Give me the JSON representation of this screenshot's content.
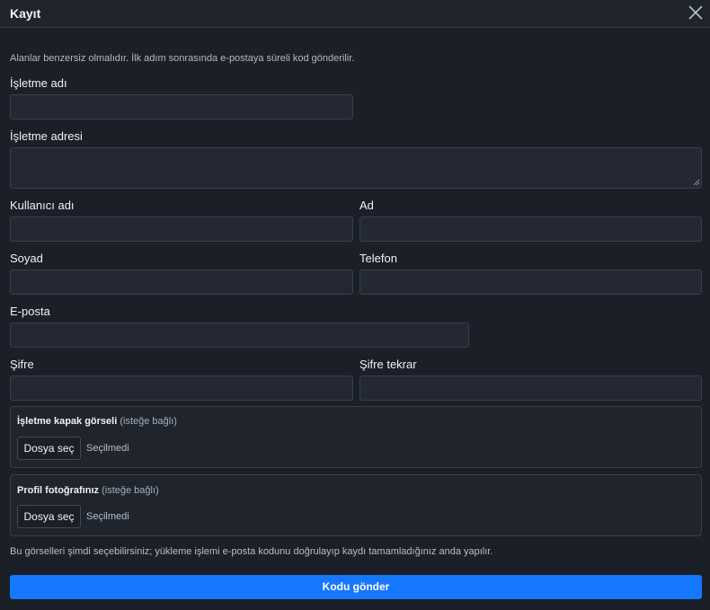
{
  "dialog": {
    "title": "Kayıt",
    "intro": "Alanlar benzersiz olmalıdır. İlk adım sonrasında e-postaya süreli kod gönderilir."
  },
  "form": {
    "business_name": {
      "label": "İşletme adı",
      "value": ""
    },
    "business_address": {
      "label": "İşletme adresi",
      "value": ""
    },
    "username": {
      "label": "Kullanıcı adı",
      "value": ""
    },
    "first_name": {
      "label": "Ad",
      "value": ""
    },
    "last_name": {
      "label": "Soyad",
      "value": ""
    },
    "phone": {
      "label": "Telefon",
      "value": ""
    },
    "email": {
      "label": "E-posta",
      "value": ""
    },
    "password": {
      "label": "Şifre",
      "value": ""
    },
    "password_confirm": {
      "label": "Şifre tekrar",
      "value": ""
    }
  },
  "uploads": {
    "cover": {
      "label": "İşletme kapak görseli",
      "optional": "(isteğe bağlı)",
      "button": "Dosya seç",
      "status": "Seçilmedi"
    },
    "profile": {
      "label": "Profil fotoğrafınız",
      "optional": "(isteğe bağlı)",
      "button": "Dosya seç",
      "status": "Seçilmedi"
    }
  },
  "note": "Bu görselleri şimdi seçebilirsiniz; yükleme işlemi e-posta kodunu doğrulayıp kaydı tamamladığınız anda yapılır.",
  "submit_label": "Kodu gönder",
  "colors": {
    "background": "#1b1f27",
    "input_bg": "#232833",
    "border": "#3a404b",
    "accent": "#1677ff"
  },
  "icons": {
    "close": "close-icon",
    "resize": "resize-grip-icon"
  }
}
